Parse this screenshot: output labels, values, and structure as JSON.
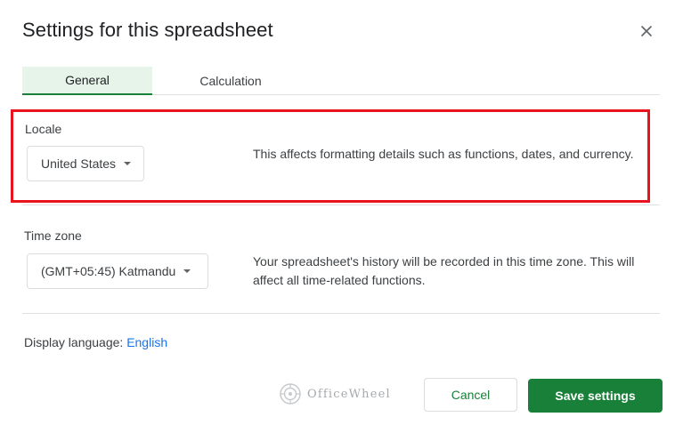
{
  "dialog": {
    "title": "Settings for this spreadsheet",
    "close_icon": "close-icon"
  },
  "tabs": [
    {
      "label": "General",
      "active": true
    },
    {
      "label": "Calculation",
      "active": false
    }
  ],
  "locale": {
    "label": "Locale",
    "selected": "United States",
    "description": "This affects formatting details such as functions, dates, and currency."
  },
  "timezone": {
    "label": "Time zone",
    "selected": "(GMT+05:45) Katmandu",
    "description": "Your spreadsheet's history will be recorded in this time zone. This will affect all time-related functions."
  },
  "display_language": {
    "label": "Display language:",
    "value": "English"
  },
  "watermark": {
    "text": "OfficeWheel"
  },
  "buttons": {
    "cancel": "Cancel",
    "save": "Save settings"
  },
  "colors": {
    "accent": "#188038",
    "link": "#1a73e8",
    "highlight_border": "#e8131c",
    "active_tab_bg": "#e6f4ea"
  }
}
